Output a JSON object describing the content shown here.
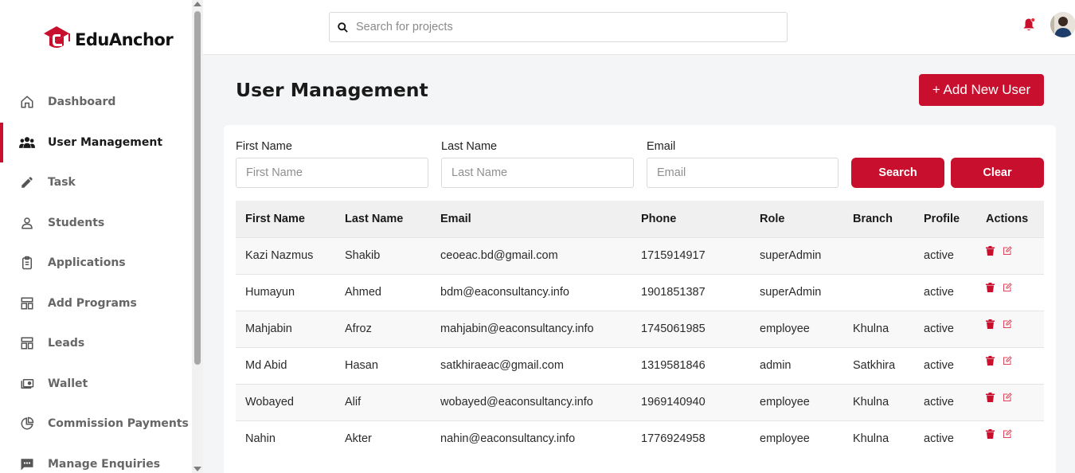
{
  "app": {
    "brand": "EduAnchor"
  },
  "sidebar": {
    "items": [
      {
        "label": "Dashboard",
        "icon": "home-icon",
        "active": false
      },
      {
        "label": "User Management",
        "icon": "users-icon",
        "active": true
      },
      {
        "label": "Task",
        "icon": "pencil-icon",
        "active": false
      },
      {
        "label": "Students",
        "icon": "person-icon",
        "active": false
      },
      {
        "label": "Applications",
        "icon": "clipboard-icon",
        "active": false
      },
      {
        "label": "Add Programs",
        "icon": "program-icon",
        "active": false
      },
      {
        "label": "Leads",
        "icon": "leads-icon",
        "active": false
      },
      {
        "label": "Wallet",
        "icon": "wallet-icon",
        "active": false
      },
      {
        "label": "Commission Payments",
        "icon": "pie-chart-icon",
        "active": false
      },
      {
        "label": "Manage Enquiries",
        "icon": "chat-icon",
        "active": false
      }
    ]
  },
  "topbar": {
    "search_placeholder": "Search for projects"
  },
  "page": {
    "title": "User Management",
    "add_button": "+ Add New User"
  },
  "filters": {
    "first_name_label": "First Name",
    "first_name_placeholder": "First Name",
    "last_name_label": "Last Name",
    "last_name_placeholder": "Last Name",
    "email_label": "Email",
    "email_placeholder": "Email",
    "search_button": "Search",
    "clear_button": "Clear"
  },
  "table": {
    "headers": [
      "First Name",
      "Last Name",
      "Email",
      "Phone",
      "Role",
      "Branch",
      "Profile",
      "Actions"
    ],
    "rows": [
      {
        "first": "Kazi Nazmus",
        "last": "Shakib",
        "email": "ceoeac.bd@gmail.com",
        "phone": "1715914917",
        "role": "superAdmin",
        "branch": "",
        "profile": "active"
      },
      {
        "first": "Humayun",
        "last": "Ahmed",
        "email": "bdm@eaconsultancy.info",
        "phone": "1901851387",
        "role": "superAdmin",
        "branch": "",
        "profile": "active"
      },
      {
        "first": "Mahjabin",
        "last": "Afroz",
        "email": "mahjabin@eaconsultancy.info",
        "phone": "1745061985",
        "role": "employee",
        "branch": "Khulna",
        "profile": "active"
      },
      {
        "first": "Md Abid",
        "last": "Hasan",
        "email": "satkhiraeac@gmail.com",
        "phone": "1319581846",
        "role": "admin",
        "branch": "Satkhira",
        "profile": "active"
      },
      {
        "first": "Wobayed",
        "last": "Alif",
        "email": "wobayed@eaconsultancy.info",
        "phone": "1969140940",
        "role": "employee",
        "branch": "Khulna",
        "profile": "active"
      },
      {
        "first": "Nahin",
        "last": "Akter",
        "email": "nahin@eaconsultancy.info",
        "phone": "1776924958",
        "role": "employee",
        "branch": "Khulna",
        "profile": "active"
      }
    ]
  },
  "colors": {
    "accent": "#c8102e",
    "background": "#f4f5f7"
  }
}
